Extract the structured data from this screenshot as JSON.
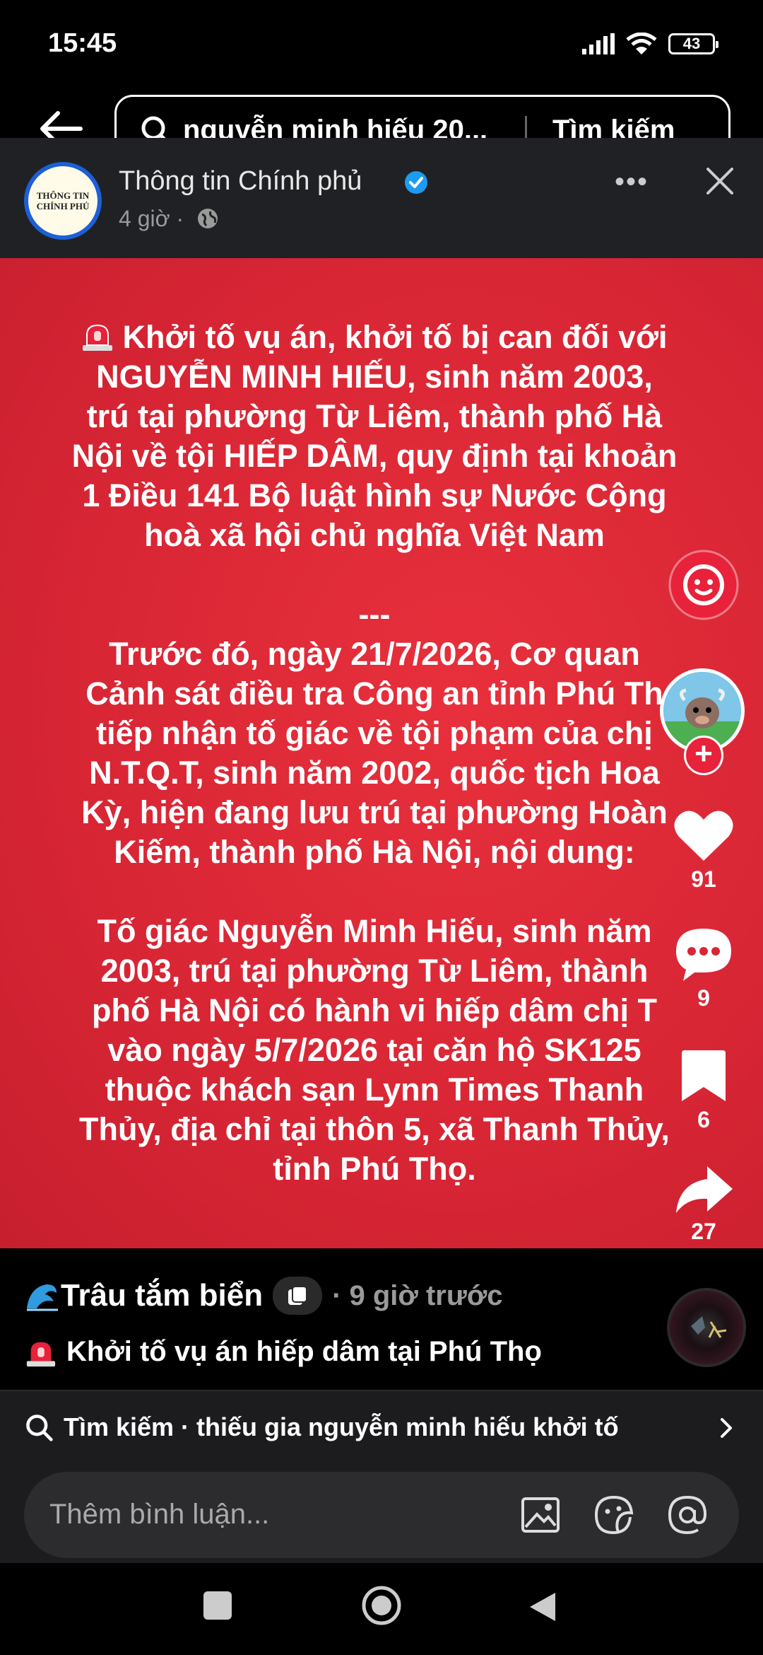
{
  "status_bar": {
    "time": "15:45",
    "battery": "43"
  },
  "search": {
    "query": "nguyễn minh hiếu 20...",
    "submit_label": "Tìm kiếm"
  },
  "post": {
    "page_name": "Thông tin Chính phủ",
    "avatar_text": [
      "THÔNG TIN",
      "CHÍNH PHỦ"
    ],
    "time": "4 giờ ·",
    "paragraph_1": "Khởi tố vụ án, khởi tố bị can đối với\nNGUYỄN MINH HIẾU, sinh năm 2003,\ntrú tại phường Từ Liêm, thành phố Hà\nNội về tội HIẾP DÂM, quy định tại khoản\n1 Điều 141 Bộ luật hình sự Nước Cộng\nhoà xã hội chủ nghĩa Việt Nam",
    "separator": "---",
    "paragraph_2": "Trước đó, ngày 21/7/2026, Cơ quan\nCảnh sát điều tra Công an tỉnh Phú Th\ntiếp nhận tố giác về tội phạm của chị\nN.T.Q.T, sinh năm 2002, quốc tịch Hoa\nKỳ, hiện đang lưu trú tại phường Hoàn\nKiếm, thành phố Hà Nội, nội dung:",
    "paragraph_3": "Tố giác Nguyễn Minh Hiếu, sinh năm\n2003, trú tại phường Từ Liêm, thành\nphố Hà Nội có hành vi hiếp dâm chị T\nvào ngày 5/7/2026 tại căn hộ SK125\nthuộc khách sạn Lynn Times Thanh\nThủy, địa chỉ tại thôn 5, xã Thanh Thủy,\ntỉnh Phú Thọ."
  },
  "rail": {
    "likes": "91",
    "comments": "9",
    "saves": "6",
    "shares": "27"
  },
  "creator": {
    "name": "Trâu tắm biển",
    "time": "· 9 giờ trước",
    "caption": "Khởi tố vụ án hiếp dâm tại Phú Thọ"
  },
  "suggestion": {
    "text": "Tìm kiếm · thiếu gia nguyễn minh hiếu khởi tố"
  },
  "comment": {
    "placeholder": "Thêm bình luận..."
  },
  "colors": {
    "post_bg": "#d92635",
    "accent": "#e8223a",
    "verified": "#1d9bf0"
  },
  "icons": [
    "back-arrow-icon",
    "search-icon",
    "verified-icon",
    "globe-icon",
    "more-icon",
    "close-icon",
    "face-icon",
    "heart-icon",
    "comment-icon",
    "bookmark-icon",
    "share-icon",
    "siren-icon",
    "wave-icon",
    "image-icon",
    "sticker-icon",
    "mention-icon",
    "chevron-right-icon"
  ]
}
